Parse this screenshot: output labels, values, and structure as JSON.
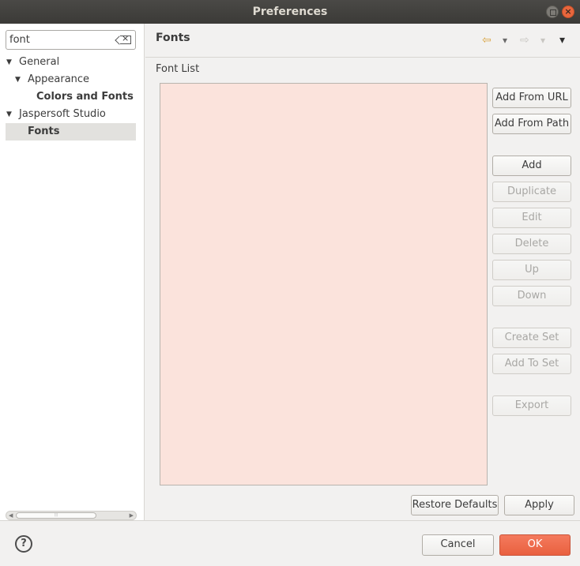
{
  "window": {
    "title": "Preferences"
  },
  "filter": {
    "value": "font"
  },
  "tree": {
    "general": "General",
    "appearance": "Appearance",
    "colors_and_fonts": "Colors and Fonts",
    "jaspersoft_studio": "Jaspersoft Studio",
    "fonts": "Fonts"
  },
  "page": {
    "title": "Fonts",
    "section_label": "Font List"
  },
  "buttons": {
    "add_from_url": "Add From URL",
    "add_from_path": "Add From Path",
    "add": "Add",
    "duplicate": "Duplicate",
    "edit": "Edit",
    "delete": "Delete",
    "up": "Up",
    "down": "Down",
    "create_set": "Create Set",
    "add_to_set": "Add To Set",
    "export": "Export",
    "restore_defaults": "Restore Defaults",
    "apply": "Apply",
    "cancel": "Cancel",
    "ok": "OK"
  },
  "icons": {
    "help": "?",
    "back": "⇦",
    "forward": "⇨",
    "dropdown": "▾",
    "menu": "▾",
    "close": "×"
  },
  "colors": {
    "accent": "#e9603f",
    "font_list_bg": "#fbe3dc",
    "titlebar": "#3b3a37"
  }
}
